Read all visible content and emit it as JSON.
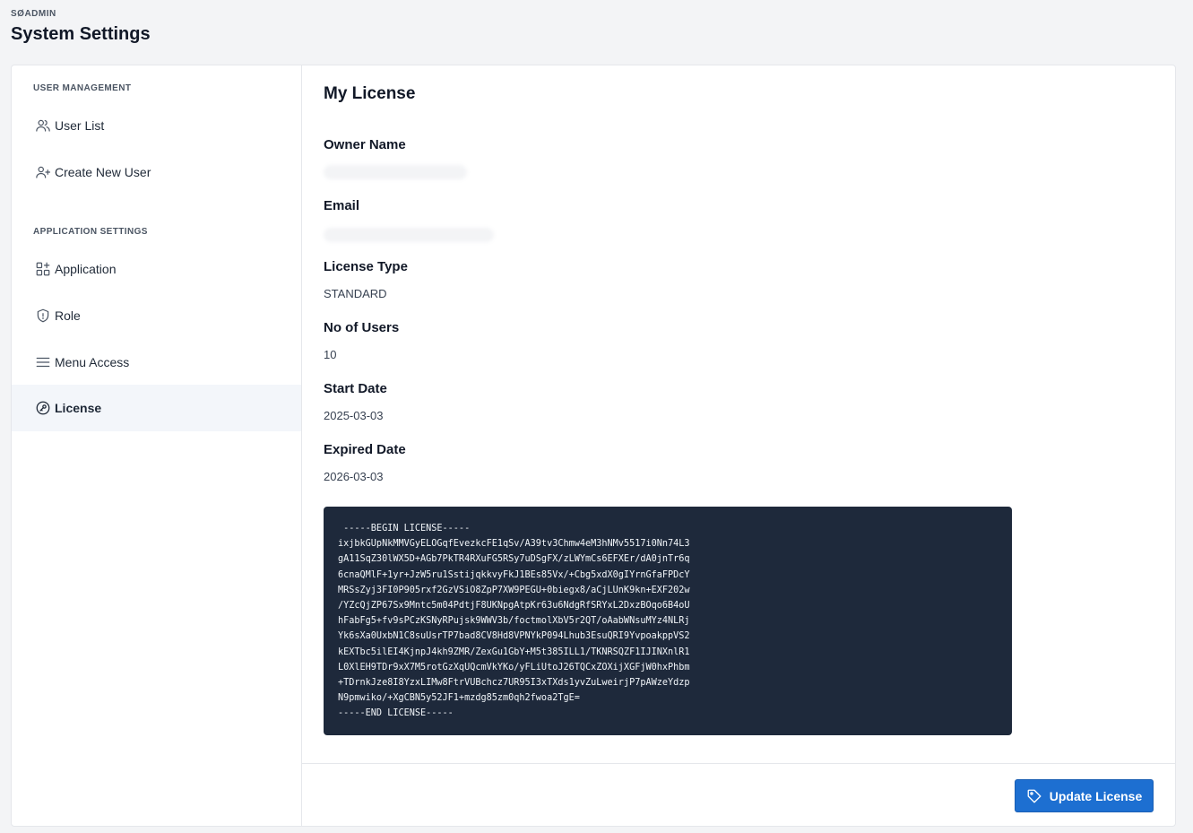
{
  "header": {
    "app_name": "SØADMIN",
    "title": "System Settings"
  },
  "sidebar": {
    "sections": [
      {
        "heading": "USER MANAGEMENT",
        "items": [
          {
            "label": "User List",
            "icon": "users-icon"
          },
          {
            "label": "Create New User",
            "icon": "user-plus-icon"
          }
        ]
      },
      {
        "heading": "APPLICATION SETTINGS",
        "items": [
          {
            "label": "Application",
            "icon": "apps-add-icon"
          },
          {
            "label": "Role",
            "icon": "shield-icon"
          },
          {
            "label": "Menu Access",
            "icon": "menu-icon"
          },
          {
            "label": "License",
            "icon": "key-circle-icon",
            "active": true
          }
        ]
      }
    ]
  },
  "main": {
    "title": "My License",
    "fields": [
      {
        "label": "Owner Name",
        "value": ""
      },
      {
        "label": "Email",
        "value": ""
      },
      {
        "label": "License Type",
        "value": "STANDARD"
      },
      {
        "label": "No of Users",
        "value": "10"
      },
      {
        "label": "Start Date",
        "value": "2025-03-03"
      },
      {
        "label": "Expired Date",
        "value": "2026-03-03"
      }
    ],
    "license_key": " -----BEGIN LICENSE-----\nixjbkGUpNkMMVGyELOGqfEvezkcFE1qSv/A39tv3Chmw4eM3hNMv5517i0Nn74L3\ngA11SqZ30lWX5D+AGb7PkTR4RXuFG5RSy7uDSgFX/zLWYmCs6EFXEr/dA0jnTr6q\n6cnaQMlF+1yr+JzW5ru1SstijqkkvyFkJ1BEs85Vx/+Cbg5xdX0gIYrnGfaFPDcY\nMRSsZyj3FI0P905rxf2GzVSiO8ZpP7XW9PEGU+0biegx8/aCjLUnK9kn+EXF202w\n/YZcQjZP67Sx9Mntc5m04PdtjF8UKNpgAtpKr63u6NdgRfSRYxL2DxzBOqo6B4oU\nhFabFg5+fv9sPCzKSNyRPujsk9WWV3b/foctmolXbV5r2QT/oAabWNsuMYz4NLRj\nYk6sXa0UxbN1C8suUsrTP7bad8CV8Hd8VPNYkP094Lhub3EsuQRI9YvpoakppVS2\nkEXTbc5ilEI4KjnpJ4kh9ZMR/ZexGu1GbY+M5t385ILL1/TKNRSQZF1IJINXnlR1\nL0XlEH9TDr9xX7M5rotGzXqUQcmVkYKo/yFLiUtoJ26TQCxZOXijXGFjW0hxPhbm\n+TDrnkJze8I8YzxLIMw8FtrVUBchcz7UR95I3xTXds1yvZuLweirjP7pAWzeYdzp\nN9pmwiko/+XgCBN5y52JF1+mzdg85zm0qh2fwoa2TgE=\n-----END LICENSE-----",
    "update_button_label": "Update License"
  },
  "colors": {
    "primary": "#1d6fd1",
    "license_bg": "#1e293b",
    "active_nav_bg": "#f3f6fa"
  }
}
